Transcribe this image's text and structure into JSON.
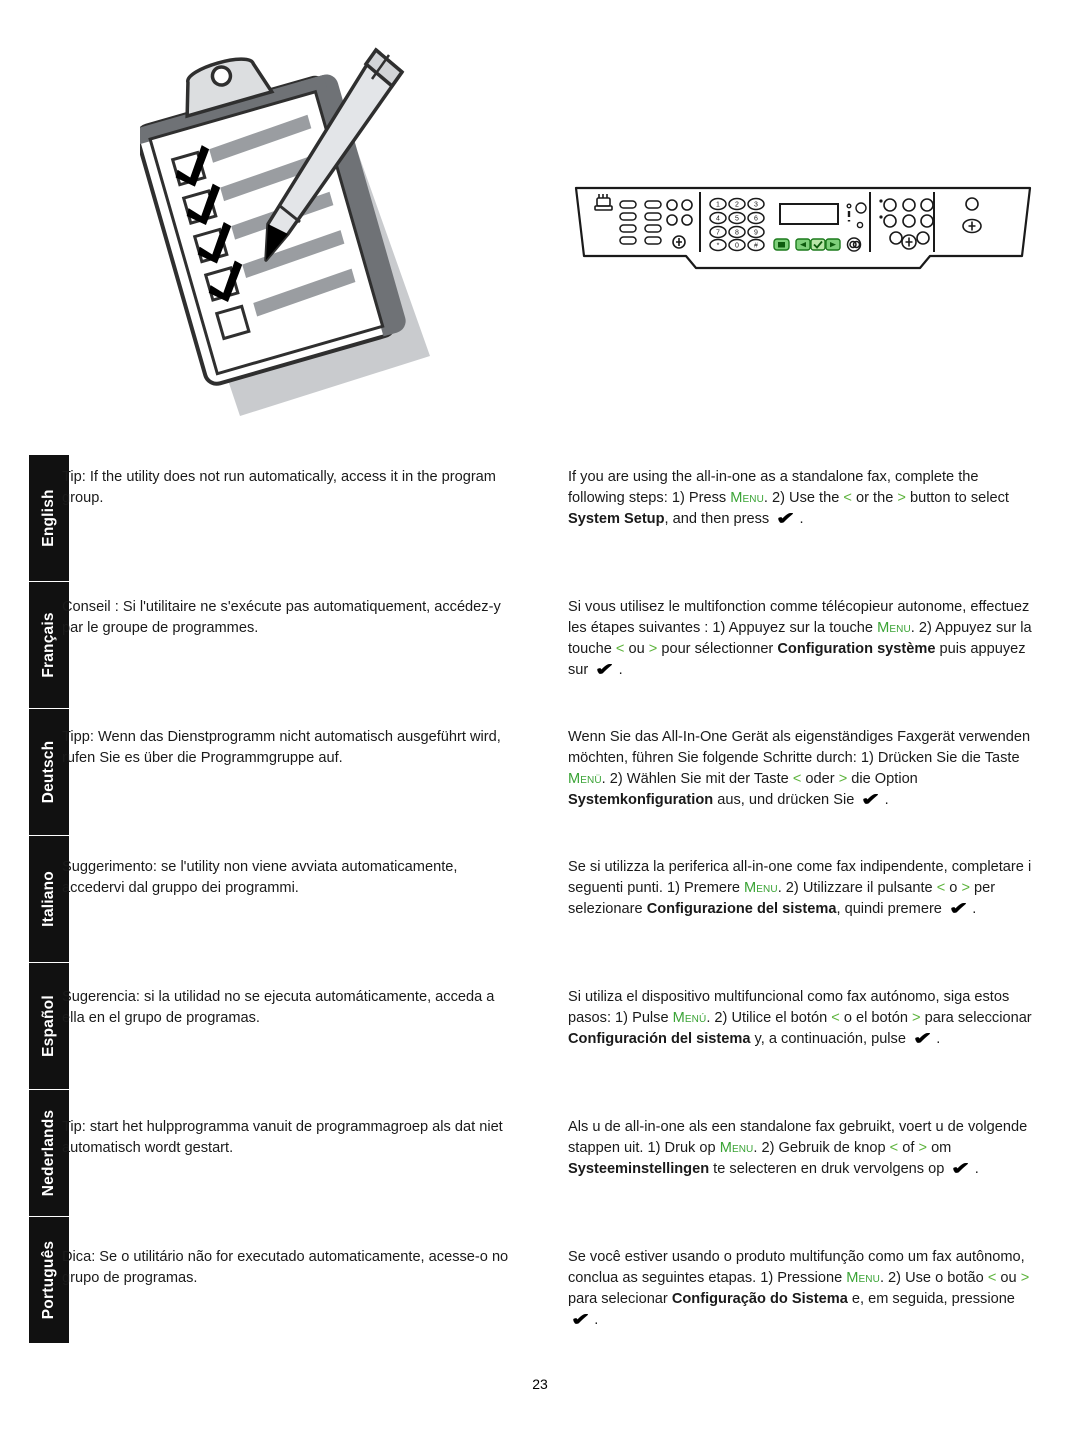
{
  "page": {
    "number": "23"
  },
  "illustrations": {
    "clipboard": {
      "name": "clipboard-checklist-with-pencil",
      "checkbox_count": 5,
      "checked_count": 4,
      "line_count": 5
    },
    "control_panel": {
      "name": "all-in-one-control-panel",
      "green_buttons": [
        "menu",
        "left-arrow",
        "check",
        "right-arrow"
      ],
      "keypad_keys": [
        "1",
        "2",
        "3",
        "4",
        "5",
        "6",
        "7",
        "8",
        "9",
        "*",
        "0",
        "#"
      ],
      "speed_dial_count": 8,
      "display": "blank-lcd"
    }
  },
  "sidebar": {
    "tabs": [
      {
        "label": "English"
      },
      {
        "label": "Français"
      },
      {
        "label": "Deutsch"
      },
      {
        "label": "Italiano"
      },
      {
        "label": "Español"
      },
      {
        "label": "Nederlands"
      },
      {
        "label": "Português"
      }
    ]
  },
  "sections": [
    {
      "language": "English",
      "left": "Tip: If the utility does not run automatically, access it in the program group.",
      "right": {
        "part1": "If you are using the all-in-one as a standalone fax, complete the following steps: 1) Press ",
        "menu_key": "Menu",
        "part2": ". 2) Use the ",
        "left_arrow": "<",
        "part3": " or the ",
        "right_arrow": ">",
        "part4": " button to select ",
        "bold_term": "System Setup",
        "part5": ", and then press ",
        "check_glyph": "✔",
        "part6": "."
      }
    },
    {
      "language": "Français",
      "left": "Conseil : Si l'utilitaire ne s'exécute pas automatiquement, accédez-y par le groupe de programmes.",
      "right": {
        "part1": "Si vous utilisez le multifonction comme télécopieur autonome, effectuez les étapes suivantes : 1) Appuyez sur la touche ",
        "menu_key": "Menu",
        "part2": ". 2) Appuyez sur la touche ",
        "left_arrow": "<",
        "part3": " ou ",
        "right_arrow": ">",
        "part4": " pour sélectionner ",
        "bold_term": "Configuration système",
        "part5": " puis appuyez sur ",
        "check_glyph": "✔",
        "part6": "."
      }
    },
    {
      "language": "Deutsch",
      "left": "Tipp: Wenn das Dienstprogramm nicht automatisch ausgeführt wird, rufen Sie es über die Programmgruppe auf.",
      "right": {
        "part1": "Wenn Sie das All-In-One Gerät als eigenständiges Faxgerät verwenden möchten, führen Sie folgende Schritte durch: 1) Drücken Sie die Taste ",
        "menu_key": "Menü",
        "part2": ". 2) Wählen Sie mit der Taste ",
        "left_arrow": "<",
        "part3": " oder ",
        "right_arrow": ">",
        "part4": " die Option ",
        "bold_term": "Systemkonfiguration",
        "part5": " aus, und drücken Sie ",
        "check_glyph": "✔",
        "part6": "."
      }
    },
    {
      "language": "Italiano",
      "left": "Suggerimento: se l'utility non viene avviata automaticamente, accedervi dal gruppo dei programmi.",
      "right": {
        "part1": "Se si utilizza la periferica all-in-one come fax indipendente, completare i seguenti punti. 1) Premere ",
        "menu_key": "Menu",
        "part2": ". 2) Utilizzare il pulsante ",
        "left_arrow": "<",
        "part3": " o ",
        "right_arrow": ">",
        "part4": " per selezionare ",
        "bold_term": "Configurazione del sistema",
        "part5": ", quindi premere ",
        "check_glyph": "✔",
        "part6": "."
      }
    },
    {
      "language": "Español",
      "left": "Sugerencia: si la utilidad no se ejecuta automáticamente, acceda a ella en el grupo de programas.",
      "right": {
        "part1": "Si utiliza el dispositivo multifuncional como fax autónomo, siga estos pasos: 1) Pulse ",
        "menu_key": "Menú",
        "part2": ". 2) Utilice el botón ",
        "left_arrow": "<",
        "part3": " o el botón ",
        "right_arrow": ">",
        "part4": " para seleccionar ",
        "bold_term": "Configuración del sistema",
        "part5": " y, a continuación, pulse ",
        "check_glyph": "✔",
        "part6": "."
      }
    },
    {
      "language": "Nederlands",
      "left": "Tip: start het hulpprogramma vanuit de programmagroep als dat niet automatisch wordt gestart.",
      "right": {
        "part1": "Als u de all-in-one als een standalone fax gebruikt, voert u de volgende stappen uit. 1) Druk op ",
        "menu_key": "Menu",
        "part2": ". 2) Gebruik de knop ",
        "left_arrow": "<",
        "part3": " of ",
        "right_arrow": ">",
        "part4": " om ",
        "bold_term": "Systeeminstellingen",
        "part5": " te selecteren en druk vervolgens op ",
        "check_glyph": "✔",
        "part6": "."
      }
    },
    {
      "language": "Português",
      "left": "Dica: Se o utilitário não for executado automaticamente, acesse-o no grupo de programas.",
      "right": {
        "part1": "Se você estiver usando o produto multifunção como um fax autônomo, conclua as seguintes etapas. 1) Pressione ",
        "menu_key": "Menu",
        "part2": ". 2) Use o botão ",
        "left_arrow": "<",
        "part3": " ou ",
        "right_arrow": ">",
        "part4": " para selecionar ",
        "bold_term": "Configuração do Sistema",
        "part5": " e, em seguida, pressione ",
        "check_glyph": "✔",
        "part6": "."
      }
    }
  ],
  "colors": {
    "menu_green": "#3aa335",
    "arrow_green": "#5cb33b",
    "tab_background": "#111111",
    "tab_text": "#ffffff"
  }
}
